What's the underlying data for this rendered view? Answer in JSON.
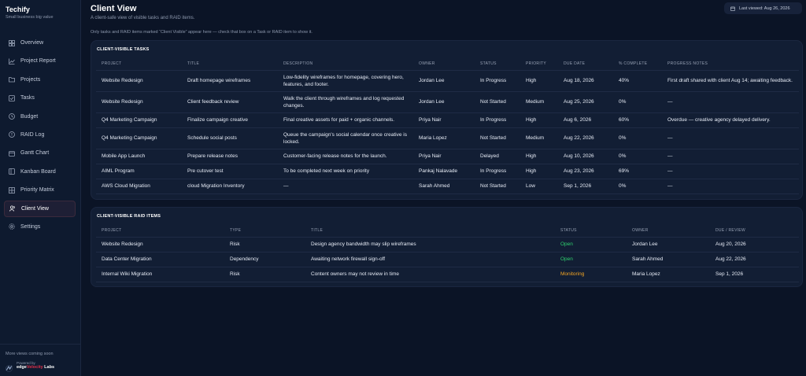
{
  "app": {
    "name": "Techify",
    "tagline": "Small business big value"
  },
  "nav": [
    {
      "label": "Overview",
      "icon": "grid-icon",
      "active": false
    },
    {
      "label": "Project Report",
      "icon": "chart-icon",
      "active": false
    },
    {
      "label": "Projects",
      "icon": "folder-icon",
      "active": false
    },
    {
      "label": "Tasks",
      "icon": "checkbox-icon",
      "active": false
    },
    {
      "label": "Budget",
      "icon": "clock-icon",
      "active": false
    },
    {
      "label": "RAID Log",
      "icon": "alert-icon",
      "active": false
    },
    {
      "label": "Gantt Chart",
      "icon": "calendar-icon",
      "active": false
    },
    {
      "label": "Kanban Board",
      "icon": "kanban-icon",
      "active": false
    },
    {
      "label": "Priority Matrix",
      "icon": "matrix-icon",
      "active": false
    },
    {
      "label": "Client View",
      "icon": "users-icon",
      "active": true
    },
    {
      "label": "Settings",
      "icon": "gear-icon",
      "active": false
    }
  ],
  "sidebar_footer": {
    "coming_soon": "More views coming soon",
    "powered_by": "Powered by",
    "brand_prefix": "edge",
    "brand_mid": "Velocity",
    "brand_suffix": " Labs"
  },
  "header": {
    "title": "Client View",
    "subtitle": "A client-safe view of visible tasks and RAID items.",
    "note": "Only tasks and RAID items marked “Client Visible” appear here — check that box on a Task or RAID item to show it.",
    "last_viewed": "Last viewed: Aug 26, 2026"
  },
  "tasks": {
    "title": "CLIENT-VISIBLE TASKS",
    "columns": [
      "PROJECT",
      "TITLE",
      "DESCRIPTION",
      "OWNER",
      "STATUS",
      "PRIORITY",
      "DUE DATE",
      "% COMPLETE",
      "PROGRESS NOTES"
    ],
    "rows": [
      [
        "Website Redesign",
        "Draft homepage wireframes",
        "Low-fidelity wireframes for homepage, covering hero, features, and footer.",
        "Jordan Lee",
        "In Progress",
        "High",
        "Aug 18, 2026",
        "40%",
        "First draft shared with client Aug 14; awaiting feedback."
      ],
      [
        "Website Redesign",
        "Client feedback review",
        "Walk the client through wireframes and log requested changes.",
        "Jordan Lee",
        "Not Started",
        "Medium",
        "Aug 25, 2026",
        "0%",
        "—"
      ],
      [
        "Q4 Marketing Campaign",
        "Finalize campaign creative",
        "Final creative assets for paid + organic channels.",
        "Priya Nair",
        "In Progress",
        "High",
        "Aug 6, 2026",
        "60%",
        "Overdue — creative agency delayed delivery."
      ],
      [
        "Q4 Marketing Campaign",
        "Schedule social posts",
        "Queue the campaign's social calendar once creative is locked.",
        "Maria Lopez",
        "Not Started",
        "Medium",
        "Aug 22, 2026",
        "0%",
        "—"
      ],
      [
        "Mobile App Launch",
        "Prepare release notes",
        "Customer-facing release notes for the launch.",
        "Priya Nair",
        "Delayed",
        "High",
        "Aug 10, 2026",
        "0%",
        "—"
      ],
      [
        "AIML Program",
        "Pre cutover test",
        "To be completed next week on priority",
        "Pankaj Nalavade",
        "In Progress",
        "High",
        "Aug 23, 2026",
        "69%",
        "—"
      ],
      [
        "AWS Cloud Migration",
        "cloud Migration Inventory",
        "—",
        "Sarah Ahmed",
        "Not Started",
        "Low",
        "Sep 1, 2026",
        "0%",
        "—"
      ]
    ]
  },
  "raid": {
    "title": "CLIENT-VISIBLE RAID ITEMS",
    "columns": [
      "PROJECT",
      "TYPE",
      "TITLE",
      "STATUS",
      "OWNER",
      "DUE / REVIEW"
    ],
    "rows": [
      [
        "Website Redesign",
        "Risk",
        "Design agency bandwidth may slip wireframes",
        "Open",
        "Jordan Lee",
        "Aug 20, 2026"
      ],
      [
        "Data Center Migration",
        "Dependency",
        "Awaiting network firewall sign-off",
        "Open",
        "Sarah Ahmed",
        "Aug 22, 2026"
      ],
      [
        "Internal Wiki Migration",
        "Risk",
        "Content owners may not review in time",
        "Monitoring",
        "Maria Lopez",
        "Sep 1, 2026"
      ]
    ]
  },
  "colors": {
    "open": "#2fcf6d",
    "monitoring": "#f5a623",
    "accent": "#e0304a"
  }
}
